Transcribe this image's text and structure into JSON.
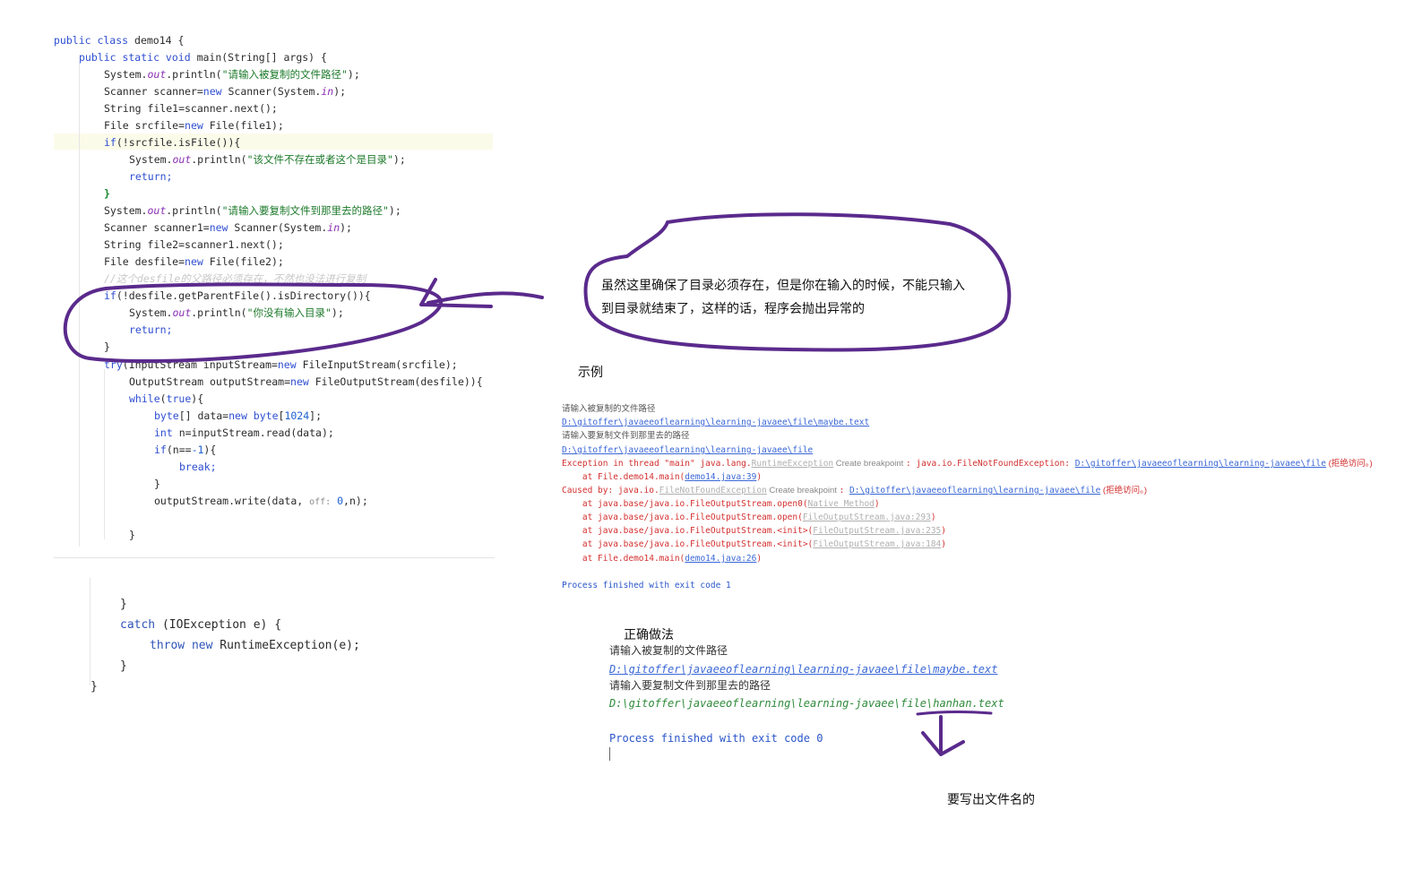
{
  "code": {
    "l1_a": "public class ",
    "l1_b": "demo14 {",
    "l2_a": "public static void ",
    "l2_b": "main(String[] args) {",
    "l3_a": "System.",
    "l3_b": "out",
    "l3_c": ".println(",
    "l3_d": "\"请输入被复制的文件路径\"",
    "l3_e": ");",
    "l4_a": "Scanner scanner=",
    "l4_b": "new ",
    "l4_c": "Scanner(System.",
    "l4_d": "in",
    "l4_e": ");",
    "l5": "String file1=scanner.next();",
    "l6_a": "File srcfile=",
    "l6_b": "new ",
    "l6_c": "File(file1);",
    "l7_a": "if",
    "l7_b": "(!srcfile.isFile()){",
    "l8_a": "System.",
    "l8_b": "out",
    "l8_c": ".println(",
    "l8_d": "\"该文件不存在或者这个是目录\"",
    "l8_e": ");",
    "l9": "return;",
    "l10": "}",
    "l11_a": "System.",
    "l11_b": "out",
    "l11_c": ".println(",
    "l11_d": "\"请输入要复制文件到那里去的路径\"",
    "l11_e": ");",
    "l12_a": "Scanner scanner1=",
    "l12_b": "new ",
    "l12_c": "Scanner(System.",
    "l12_d": "in",
    "l12_e": ");",
    "l13": "String file2=scanner1.next();",
    "l14_a": "File desfile=",
    "l14_b": "new ",
    "l14_c": "File(file2);",
    "l15": "//这个desfile的父路径必须存在，不然也没法进行复制",
    "l16_a": "if",
    "l16_b": "(!desfile.getParentFile().isDirectory()){",
    "l17_a": "System.",
    "l17_b": "out",
    "l17_c": ".println(",
    "l17_d": "\"你没有输入目录\"",
    "l17_e": ");",
    "l18": "return;",
    "l19": "}",
    "l20_a": "try",
    "l20_b": "(InputStream inputStream=",
    "l20_c": "new ",
    "l20_d": "FileInputStream(srcfile);",
    "l21_a": "OutputStream outputStream=",
    "l21_b": "new ",
    "l21_c": "FileOutputStream(desfile)){",
    "l22_a": "while",
    "l22_b": "(",
    "l22_c": "true",
    "l22_d": "){",
    "l23_a": "byte",
    "l23_b": "[] data=",
    "l23_c": "new ",
    "l23_d": "byte",
    "l23_e": "[",
    "l23_f": "1024",
    "l23_g": "];",
    "l24_a": "int ",
    "l24_b": "n=inputStream.read(data);",
    "l25_a": "if",
    "l25_b": "(n==",
    "l25_c": "-1",
    "l25_d": "){",
    "l26": "break;",
    "l27": "}",
    "l28_a": "outputStream.write(data, ",
    "l28_hint": "off:",
    "l28_b": " 0",
    "l28_c": ",n);",
    "l29": "}"
  },
  "code2": {
    "l1": "}",
    "l2_a": "catch ",
    "l2_b": "(IOException e) {",
    "l3_a": "throw new ",
    "l3_b": "RuntimeException(e);",
    "l4": "}",
    "l5": "}"
  },
  "annotations": {
    "bubble_text_1": "虽然这里确保了目录必须存在，但是你在输入的时候，不能只输入",
    "bubble_text_2": "到目录就结束了，这样的话，程序会抛出异常的",
    "example_label": "示例",
    "correct_label": "正确做法",
    "filename_note": "要写出文件名的"
  },
  "console1": {
    "line1": "请输入被复制的文件路径",
    "line2": "D:\\gitoffer\\javaeeoflearning\\learning-javaee\\file\\maybe.text",
    "line3": "请输入要复制文件到那里去的路径",
    "line4": "D:\\gitoffer\\javaeeoflearning\\learning-javaee\\file",
    "line5_a": "Exception in thread \"main\" java.lang.",
    "line5_b": "RuntimeException",
    "line5_c": " Create breakpoint ",
    "line5_d": ": java.io.FileNotFoundException: ",
    "line5_e": "D:\\gitoffer\\javaeeoflearning\\learning-javaee\\file",
    "line5_f": " (拒绝访问。)",
    "line6_a": "    at File.demo14.main(",
    "line6_b": "demo14.java:39",
    "line6_c": ")",
    "line7_a": "Caused by: java.io.",
    "line7_b": "FileNotFoundException",
    "line7_c": " Create breakpoint ",
    "line7_d": ": ",
    "line7_e": "D:\\gitoffer\\javaeeoflearning\\learning-javaee\\file",
    "line7_f": " (拒绝访问。)",
    "line8_a": "    at java.base/java.io.FileOutputStream.open0(",
    "line8_b": "Native Method",
    "line8_c": ")",
    "line9_a": "    at java.base/java.io.FileOutputStream.open(",
    "line9_b": "FileOutputStream.java:293",
    "line9_c": ")",
    "line10_a": "    at java.base/java.io.FileOutputStream.<init>(",
    "line10_b": "FileOutputStream.java:235",
    "line10_c": ")",
    "line11_a": "    at java.base/java.io.FileOutputStream.<init>(",
    "line11_b": "FileOutputStream.java:184",
    "line11_c": ")",
    "line12_a": "    at File.demo14.main(",
    "line12_b": "demo14.java:26",
    "line12_c": ")",
    "line13": "Process finished with exit code 1"
  },
  "console2": {
    "line1": "请输入被复制的文件路径",
    "line2": "D:\\gitoffer\\javaeeoflearning\\learning-javaee\\file\\maybe.text",
    "line3": "请输入要复制文件到那里去的路径",
    "line4": "D:\\gitoffer\\javaeeoflearning\\learning-javaee\\file\\hanhan.text",
    "line5": "Process finished with exit code 0"
  },
  "colors": {
    "ink": "#5a2a8c",
    "keyword": "#2f4fd1",
    "string": "#1d7a2b",
    "error": "#d32f2f"
  }
}
